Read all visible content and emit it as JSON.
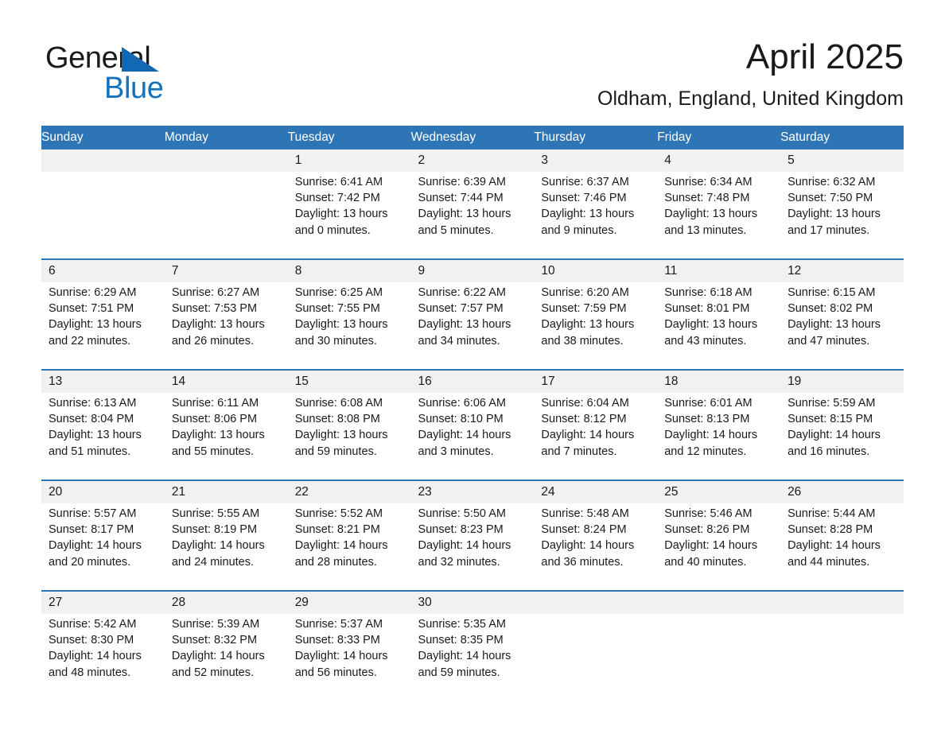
{
  "brand": {
    "word1": "General",
    "word2": "Blue",
    "triangle_color": "#1268b3",
    "word2_color": "#1272bd"
  },
  "header": {
    "title": "April 2025",
    "location": "Oldham, England, United Kingdom"
  },
  "theme": {
    "header_blue": "#2e75b6",
    "daynum_gray": "#f1f1f1",
    "text": "#1a1a1a",
    "cell_white": "#ffffff"
  },
  "weekdays": [
    "Sunday",
    "Monday",
    "Tuesday",
    "Wednesday",
    "Thursday",
    "Friday",
    "Saturday"
  ],
  "weeks": [
    {
      "days": [
        {
          "num": "",
          "sunrise": "",
          "sunset": "",
          "daylight": "",
          "daylight2": ""
        },
        {
          "num": "",
          "sunrise": "",
          "sunset": "",
          "daylight": "",
          "daylight2": ""
        },
        {
          "num": "1",
          "sunrise": "Sunrise: 6:41 AM",
          "sunset": "Sunset: 7:42 PM",
          "daylight": "Daylight: 13 hours",
          "daylight2": "and 0 minutes."
        },
        {
          "num": "2",
          "sunrise": "Sunrise: 6:39 AM",
          "sunset": "Sunset: 7:44 PM",
          "daylight": "Daylight: 13 hours",
          "daylight2": "and 5 minutes."
        },
        {
          "num": "3",
          "sunrise": "Sunrise: 6:37 AM",
          "sunset": "Sunset: 7:46 PM",
          "daylight": "Daylight: 13 hours",
          "daylight2": "and 9 minutes."
        },
        {
          "num": "4",
          "sunrise": "Sunrise: 6:34 AM",
          "sunset": "Sunset: 7:48 PM",
          "daylight": "Daylight: 13 hours",
          "daylight2": "and 13 minutes."
        },
        {
          "num": "5",
          "sunrise": "Sunrise: 6:32 AM",
          "sunset": "Sunset: 7:50 PM",
          "daylight": "Daylight: 13 hours",
          "daylight2": "and 17 minutes."
        }
      ]
    },
    {
      "days": [
        {
          "num": "6",
          "sunrise": "Sunrise: 6:29 AM",
          "sunset": "Sunset: 7:51 PM",
          "daylight": "Daylight: 13 hours",
          "daylight2": "and 22 minutes."
        },
        {
          "num": "7",
          "sunrise": "Sunrise: 6:27 AM",
          "sunset": "Sunset: 7:53 PM",
          "daylight": "Daylight: 13 hours",
          "daylight2": "and 26 minutes."
        },
        {
          "num": "8",
          "sunrise": "Sunrise: 6:25 AM",
          "sunset": "Sunset: 7:55 PM",
          "daylight": "Daylight: 13 hours",
          "daylight2": "and 30 minutes."
        },
        {
          "num": "9",
          "sunrise": "Sunrise: 6:22 AM",
          "sunset": "Sunset: 7:57 PM",
          "daylight": "Daylight: 13 hours",
          "daylight2": "and 34 minutes."
        },
        {
          "num": "10",
          "sunrise": "Sunrise: 6:20 AM",
          "sunset": "Sunset: 7:59 PM",
          "daylight": "Daylight: 13 hours",
          "daylight2": "and 38 minutes."
        },
        {
          "num": "11",
          "sunrise": "Sunrise: 6:18 AM",
          "sunset": "Sunset: 8:01 PM",
          "daylight": "Daylight: 13 hours",
          "daylight2": "and 43 minutes."
        },
        {
          "num": "12",
          "sunrise": "Sunrise: 6:15 AM",
          "sunset": "Sunset: 8:02 PM",
          "daylight": "Daylight: 13 hours",
          "daylight2": "and 47 minutes."
        }
      ]
    },
    {
      "days": [
        {
          "num": "13",
          "sunrise": "Sunrise: 6:13 AM",
          "sunset": "Sunset: 8:04 PM",
          "daylight": "Daylight: 13 hours",
          "daylight2": "and 51 minutes."
        },
        {
          "num": "14",
          "sunrise": "Sunrise: 6:11 AM",
          "sunset": "Sunset: 8:06 PM",
          "daylight": "Daylight: 13 hours",
          "daylight2": "and 55 minutes."
        },
        {
          "num": "15",
          "sunrise": "Sunrise: 6:08 AM",
          "sunset": "Sunset: 8:08 PM",
          "daylight": "Daylight: 13 hours",
          "daylight2": "and 59 minutes."
        },
        {
          "num": "16",
          "sunrise": "Sunrise: 6:06 AM",
          "sunset": "Sunset: 8:10 PM",
          "daylight": "Daylight: 14 hours",
          "daylight2": "and 3 minutes."
        },
        {
          "num": "17",
          "sunrise": "Sunrise: 6:04 AM",
          "sunset": "Sunset: 8:12 PM",
          "daylight": "Daylight: 14 hours",
          "daylight2": "and 7 minutes."
        },
        {
          "num": "18",
          "sunrise": "Sunrise: 6:01 AM",
          "sunset": "Sunset: 8:13 PM",
          "daylight": "Daylight: 14 hours",
          "daylight2": "and 12 minutes."
        },
        {
          "num": "19",
          "sunrise": "Sunrise: 5:59 AM",
          "sunset": "Sunset: 8:15 PM",
          "daylight": "Daylight: 14 hours",
          "daylight2": "and 16 minutes."
        }
      ]
    },
    {
      "days": [
        {
          "num": "20",
          "sunrise": "Sunrise: 5:57 AM",
          "sunset": "Sunset: 8:17 PM",
          "daylight": "Daylight: 14 hours",
          "daylight2": "and 20 minutes."
        },
        {
          "num": "21",
          "sunrise": "Sunrise: 5:55 AM",
          "sunset": "Sunset: 8:19 PM",
          "daylight": "Daylight: 14 hours",
          "daylight2": "and 24 minutes."
        },
        {
          "num": "22",
          "sunrise": "Sunrise: 5:52 AM",
          "sunset": "Sunset: 8:21 PM",
          "daylight": "Daylight: 14 hours",
          "daylight2": "and 28 minutes."
        },
        {
          "num": "23",
          "sunrise": "Sunrise: 5:50 AM",
          "sunset": "Sunset: 8:23 PM",
          "daylight": "Daylight: 14 hours",
          "daylight2": "and 32 minutes."
        },
        {
          "num": "24",
          "sunrise": "Sunrise: 5:48 AM",
          "sunset": "Sunset: 8:24 PM",
          "daylight": "Daylight: 14 hours",
          "daylight2": "and 36 minutes."
        },
        {
          "num": "25",
          "sunrise": "Sunrise: 5:46 AM",
          "sunset": "Sunset: 8:26 PM",
          "daylight": "Daylight: 14 hours",
          "daylight2": "and 40 minutes."
        },
        {
          "num": "26",
          "sunrise": "Sunrise: 5:44 AM",
          "sunset": "Sunset: 8:28 PM",
          "daylight": "Daylight: 14 hours",
          "daylight2": "and 44 minutes."
        }
      ]
    },
    {
      "days": [
        {
          "num": "27",
          "sunrise": "Sunrise: 5:42 AM",
          "sunset": "Sunset: 8:30 PM",
          "daylight": "Daylight: 14 hours",
          "daylight2": "and 48 minutes."
        },
        {
          "num": "28",
          "sunrise": "Sunrise: 5:39 AM",
          "sunset": "Sunset: 8:32 PM",
          "daylight": "Daylight: 14 hours",
          "daylight2": "and 52 minutes."
        },
        {
          "num": "29",
          "sunrise": "Sunrise: 5:37 AM",
          "sunset": "Sunset: 8:33 PM",
          "daylight": "Daylight: 14 hours",
          "daylight2": "and 56 minutes."
        },
        {
          "num": "30",
          "sunrise": "Sunrise: 5:35 AM",
          "sunset": "Sunset: 8:35 PM",
          "daylight": "Daylight: 14 hours",
          "daylight2": "and 59 minutes."
        },
        {
          "num": "",
          "sunrise": "",
          "sunset": "",
          "daylight": "",
          "daylight2": ""
        },
        {
          "num": "",
          "sunrise": "",
          "sunset": "",
          "daylight": "",
          "daylight2": ""
        },
        {
          "num": "",
          "sunrise": "",
          "sunset": "",
          "daylight": "",
          "daylight2": ""
        }
      ]
    }
  ]
}
